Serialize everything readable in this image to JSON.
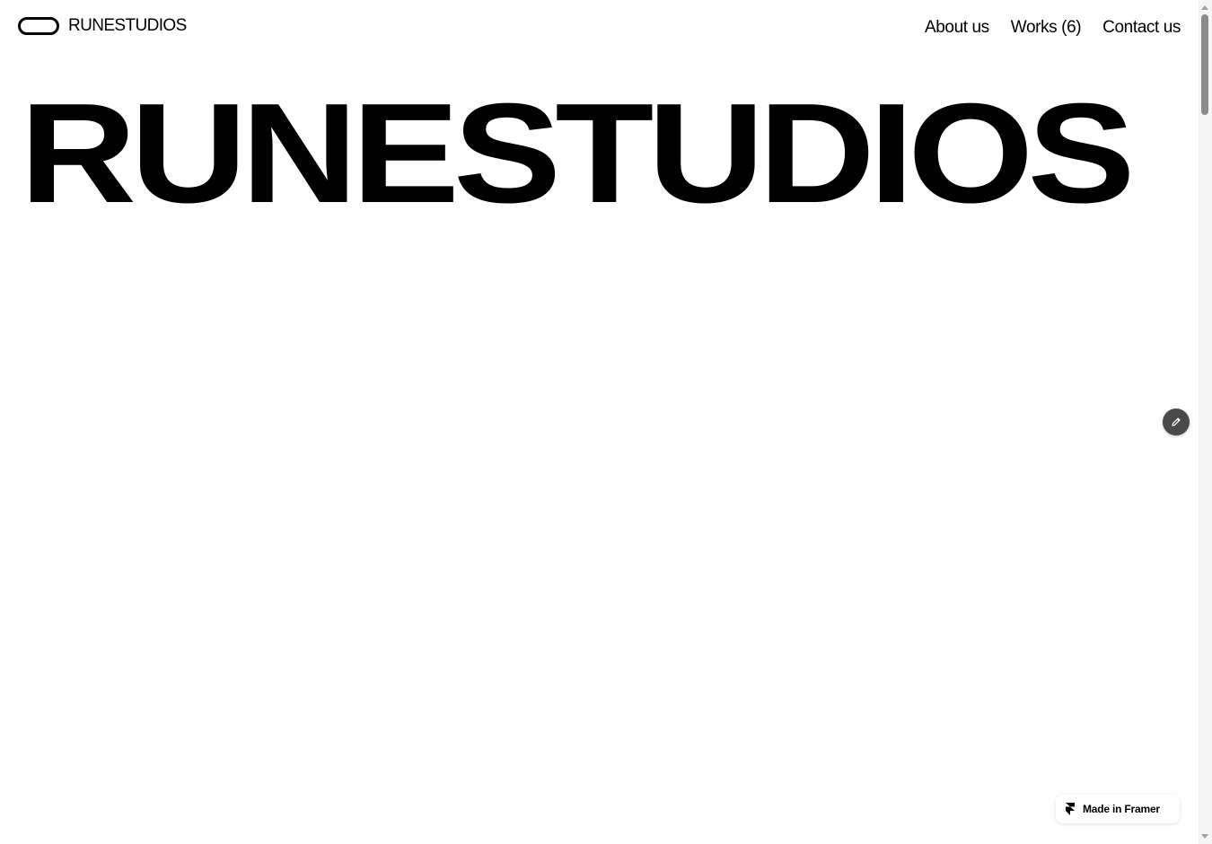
{
  "header": {
    "brand_name": "RUNESTUDIOS",
    "nav": [
      {
        "label": "About us"
      },
      {
        "label": "Works (6)"
      },
      {
        "label": "Contact us"
      }
    ]
  },
  "hero": {
    "title": "RUNESTUDIOS"
  },
  "badge": {
    "label": "Made in Framer",
    "icon": "framer-logo-icon"
  },
  "floating": {
    "icon": "pencil-icon"
  },
  "colors": {
    "background": "#ffffff",
    "text": "#000000",
    "edit_button": "#4a4a4a"
  }
}
